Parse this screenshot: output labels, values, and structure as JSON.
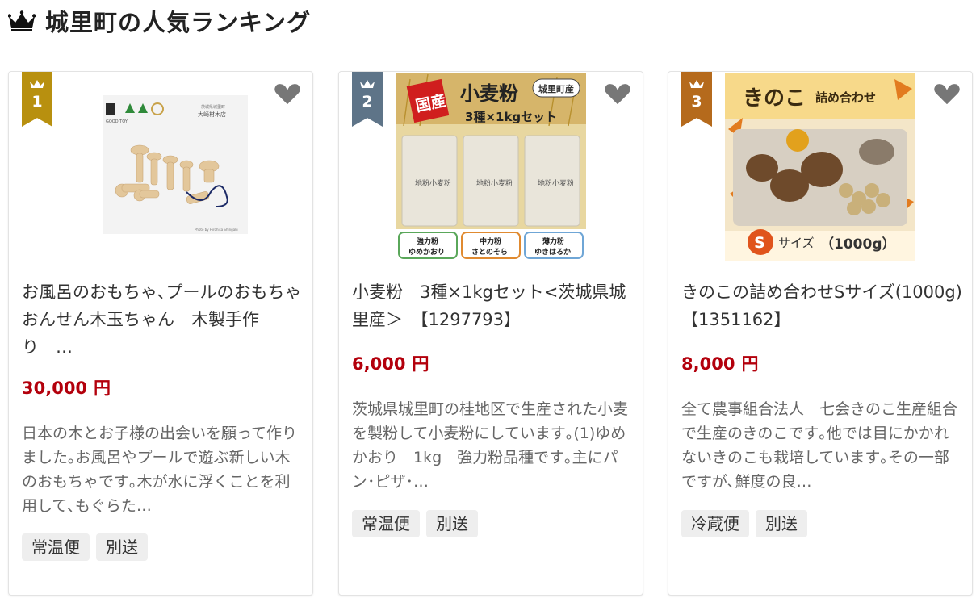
{
  "heading": {
    "title": "城里町の人気ランキング",
    "icon": "crown-icon"
  },
  "colors": {
    "gold": "#b8900f",
    "silver": "#5e7488",
    "bronze": "#b56a1c",
    "price": "#b3000c",
    "tag_bg": "#eeeeee"
  },
  "items": [
    {
      "rank": "1",
      "title": "お風呂のおもちゃ､プールのおもちゃ　おんせん木玉ちゃん　木製手作り　…",
      "price": "30,000",
      "price_unit": "円",
      "description": "日本の木とお子様の出会いを願って作りました｡お風呂やプールで遊ぶ新しい木のおもちゃです｡木が水に浮くことを利用して､もぐらた…",
      "tags": [
        "常温便",
        "別送"
      ],
      "image_caption": "大崎材木店",
      "image_small_text": "Photo by Hirohisa Shingaki",
      "image_logo_text": "GOOD TOY",
      "image_maker_text": "茨城県城里町"
    },
    {
      "rank": "2",
      "title": "小麦粉　3種×1kgセット<茨城県城里産＞　【1297793】",
      "price": "6,000",
      "price_unit": "円",
      "description": "茨城県城里町の桂地区で生産された小麦を製粉して小麦粉にしています｡(1)ゆめかおり　1kg　強力粉品種です｡主にパン･ピザ･…",
      "tags": [
        "常温便",
        "別送"
      ],
      "image_badge": "国産",
      "image_title": "小麦粉",
      "image_subtitle": "3種×1kgセット",
      "image_stamp": "城里町産",
      "image_bag_text": "地粉小麦粉",
      "image_labels": [
        {
          "line1": "強力粉",
          "line2": "ゆめかおり"
        },
        {
          "line1": "中力粉",
          "line2": "さとのそら"
        },
        {
          "line1": "薄力粉",
          "line2": "ゆきはるか"
        }
      ]
    },
    {
      "rank": "3",
      "title": "きのこの詰め合わせSサイズ(1000g)【1351162】",
      "price": "8,000",
      "price_unit": "円",
      "description": "全て農事組合法人　七会きのこ生産組合で生産のきのこです｡他では目にかかれないきのこも栽培しています｡その一部ですが､鮮度の良…",
      "tags": [
        "冷蔵便",
        "別送"
      ],
      "image_title_big": "きのこ",
      "image_title_small": "詰め合わせ",
      "image_size_letter": "S",
      "image_size_text": "サイズ",
      "image_weight": "（1000g）"
    }
  ]
}
